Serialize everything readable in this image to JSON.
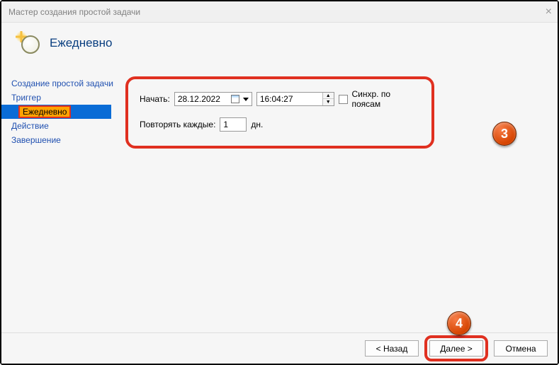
{
  "window": {
    "title": "Мастер создания простой задачи"
  },
  "header": {
    "title": "Ежедневно"
  },
  "sidebar": {
    "items": [
      {
        "label": "Создание простой задачи"
      },
      {
        "label": "Триггер"
      },
      {
        "label": "Ежедневно",
        "current": true
      },
      {
        "label": "Действие"
      },
      {
        "label": "Завершение"
      }
    ]
  },
  "form": {
    "start_label": "Начать:",
    "date_value": "28.12.2022",
    "time_value": "16:04:27",
    "sync_label": "Синхр. по поясам",
    "recur_label": "Повторять каждые:",
    "recur_value": "1",
    "recur_unit": "дн."
  },
  "buttons": {
    "back": "< Назад",
    "next": "Далее >",
    "cancel": "Отмена"
  },
  "badges": {
    "b3": "3",
    "b4": "4"
  }
}
